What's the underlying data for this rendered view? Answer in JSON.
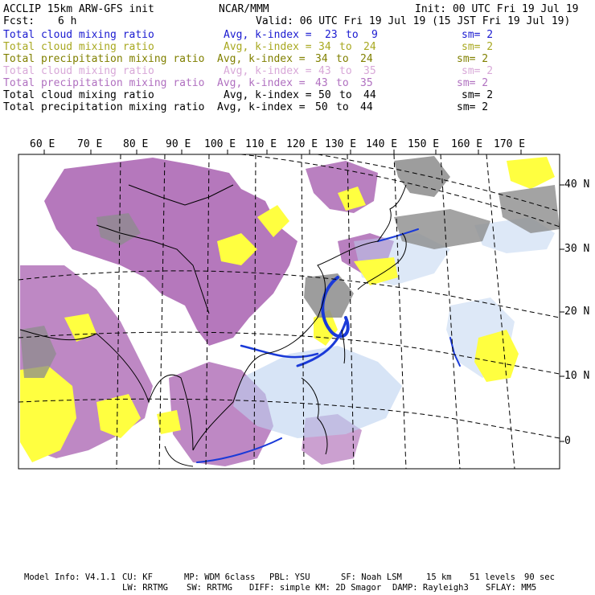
{
  "header": {
    "model": "ACCLIP 15km ARW-GFS init",
    "org": "NCAR/MMM",
    "init": "Init: 00 UTC Fri 19 Jul 19",
    "fcst_label": "Fcst:",
    "fcst_value": "6 h",
    "valid": "Valid: 06 UTC Fri 19 Jul 19 (15 JST Fri 19 Jul 19)"
  },
  "fields": [
    {
      "name": "Total cloud mixing ratio",
      "avg": "Avg, k-index =",
      "from": "23",
      "to_word": "to",
      "to": "9",
      "sm": "sm= 2",
      "color": "#1a1ad0"
    },
    {
      "name": "Total cloud mixing ratio",
      "avg": "Avg, k-index =",
      "from": "34",
      "to_word": "to",
      "to": "24",
      "sm": "sm= 2",
      "color": "#a8a820"
    },
    {
      "name": "Total precipitation mixing ratio",
      "avg": "Avg, k-index =",
      "from": "34",
      "to_word": "to",
      "to": "24",
      "sm": "sm= 2",
      "color": "#808000"
    },
    {
      "name": "Total cloud mixing ratio",
      "avg": "Avg, k-index =",
      "from": "43",
      "to_word": "to",
      "to": "35",
      "sm": "sm= 2",
      "color": "#d8a8d8"
    },
    {
      "name": "Total precipitation mixing ratio",
      "avg": "Avg, k-index =",
      "from": "43",
      "to_word": "to",
      "to": "35",
      "sm": "sm= 2",
      "color": "#b070c0"
    },
    {
      "name": "Total cloud mixing ratio",
      "avg": "Avg, k-index =",
      "from": "50",
      "to_word": "to",
      "to": "44",
      "sm": "sm= 2",
      "color": "#000000"
    },
    {
      "name": "Total precipitation mixing ratio",
      "avg": "Avg, k-index =",
      "from": "50",
      "to_word": "to",
      "to": "44",
      "sm": "sm= 2",
      "color": "#000000"
    }
  ],
  "map": {
    "lon_labels": [
      "60 E",
      "70 E",
      "80 E",
      "90 E",
      "100 E",
      "110 E",
      "120 E",
      "130 E",
      "140 E",
      "150 E",
      "160 E",
      "170 E"
    ],
    "lat_labels": [
      "40 N",
      "30 N",
      "20 N",
      "10 N",
      "0"
    ],
    "colors": {
      "blue": "#1a3ad8",
      "lightblue": "#bcd2f0",
      "yellow": "#ffff40",
      "purple": "#a860b0",
      "gray": "#8c8c8c",
      "black": "#000000"
    }
  },
  "footer": {
    "line1": [
      "Model Info: V4.1.1",
      "CU: KF",
      "MP: WDM 6class",
      "PBL: YSU",
      "SF: Noah LSM",
      "15 km",
      "51 levels",
      "90 sec"
    ],
    "line2": [
      "LW: RRTMG",
      "SW: RRTMG",
      "DIFF: simple",
      "KM: 2D Smagor",
      "DAMP: Rayleigh3",
      "SFLAY: MM5"
    ]
  }
}
